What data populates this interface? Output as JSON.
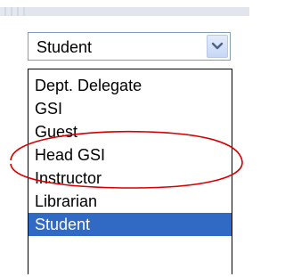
{
  "select": {
    "value": "Student",
    "arrow_icon": "chevron-down-icon"
  },
  "options": [
    "Dept. Delegate",
    "GSI",
    "Guest",
    "Head GSI",
    "Instructor",
    "Librarian",
    "Student"
  ],
  "selected_option": "Student",
  "colors": {
    "selection_bg": "#316ac5",
    "annotation_circle": "#d80000",
    "select_border": "#7f9db9"
  },
  "annotation": {
    "shape": "hand-drawn-ellipse",
    "highlights": "Head GSI"
  }
}
